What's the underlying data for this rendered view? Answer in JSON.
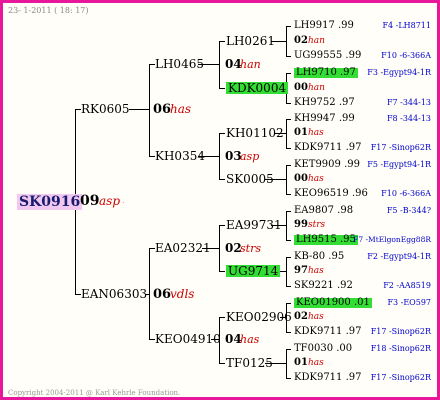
{
  "header": {
    "date": "23-  1-2011  ( 18: 17)"
  },
  "footer": {
    "copyright": "Copyright 2004-2011 @ Karl Kehrle Foundation."
  },
  "root": {
    "id": "SK0916",
    "num": "09",
    "name": "asp",
    "dots": "."
  },
  "gen1": [
    {
      "id": "RK0605",
      "num": "06",
      "name": "has"
    },
    {
      "id": "EAN06303",
      "num": "06",
      "name": "vdls"
    }
  ],
  "gen2": [
    {
      "id": "LH0465",
      "num": "04",
      "name": "han"
    },
    {
      "id": "KH0354",
      "num": "03",
      "name": "asp"
    },
    {
      "id": "EA02321",
      "num": "02",
      "name": "strs"
    },
    {
      "id": "KEO04910",
      "num": "04",
      "name": "has"
    }
  ],
  "gen3": [
    {
      "id": "LH0261",
      "num": "02",
      "name": "han"
    },
    {
      "id": "KDK0004"
    },
    {
      "id": "KH01102",
      "num": "01",
      "name": "has"
    },
    {
      "id": "SK0005"
    },
    {
      "id": "EA99731",
      "num": "02",
      "name": "strs"
    },
    {
      "id": "UG9714"
    },
    {
      "id": "KEO02906",
      "num": "02",
      "name": "has"
    },
    {
      "id": "TF0125"
    }
  ],
  "gen4": [
    {
      "id": "LH9917 .99",
      "info": "F4 -LH8711"
    },
    {
      "num": "02",
      "name": "han"
    },
    {
      "id": "UG99555 .99",
      "info": "F10 -6-366A"
    },
    {
      "id": "LH9710 .97",
      "info": "F3 -Egypt94-1R"
    },
    {
      "num": "00",
      "name": "han"
    },
    {
      "id": "KH9752 .97",
      "info": "F7 -344-13"
    },
    {
      "id": "KH9947 .99",
      "info": "F8 -344-13"
    },
    {
      "num": "01",
      "name": "has"
    },
    {
      "id": "KDK9711 .97",
      "info": "F17 -Sinop62R"
    },
    {
      "id": "KET9909 .99",
      "info": "F5 -Egypt94-1R"
    },
    {
      "num": "00",
      "name": "has"
    },
    {
      "id": "KEO96519 .96",
      "info": "F10 -6-366A"
    },
    {
      "id": "EA9807 .98",
      "info": "F5 -B-344?"
    },
    {
      "num": "99",
      "name": "strs"
    },
    {
      "id": "LH9515 .95",
      "info": "F7 -MtElgonEgg88R"
    },
    {
      "id": "KB-80 .95",
      "info": "F2 -Egypt94-1R"
    },
    {
      "num": "97",
      "name": "has"
    },
    {
      "id": "SK9221 .92",
      "info": "F2 -AA8519"
    },
    {
      "id": "KEO01900 .01",
      "info": "F3 -EO597"
    },
    {
      "num": "02",
      "name": "has"
    },
    {
      "id": "KDK9711 .97",
      "info": "F17 -Sinop62R"
    },
    {
      "id": "TF0030 .00",
      "info": "F18 -Sinop62R"
    },
    {
      "num": "01",
      "name": "has"
    },
    {
      "id": "KDK9711 .97",
      "info": "F17 -Sinop62R"
    }
  ],
  "colors": {
    "frame": "#e8189a",
    "highlight": "#33dd33",
    "root_bg": "#f0c8f0",
    "name": "#cc0000",
    "info": "#0000cc"
  }
}
